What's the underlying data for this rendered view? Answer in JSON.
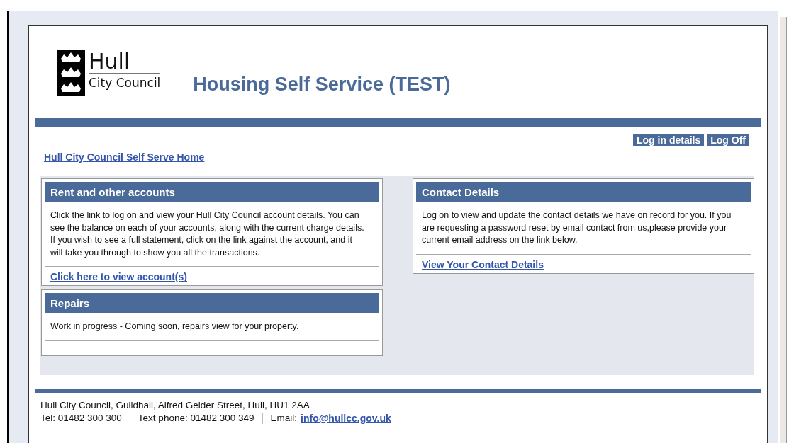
{
  "logo": {
    "name": "Hull",
    "subtitle": "City Council"
  },
  "title": "Housing Self Service (TEST)",
  "top_buttons": [
    "Log in details",
    "Log Off"
  ],
  "home_link": "Hull City Council Self Serve Home",
  "left_panels": [
    {
      "heading": "Rent and other accounts",
      "text": "Click the link to log on and view your Hull City Council account details. You can see the balance on each of your accounts, along with the current charge details. If you wish to see a full statement, click on the link against the account, and it will take you through to show you all the transactions.",
      "link": "Click here to view account(s)"
    },
    {
      "heading": "Repairs",
      "text": "Work in progress - Coming soon, repairs view for your property."
    }
  ],
  "right_panels": [
    {
      "heading": "Contact Details",
      "text": "Log on to view and update the contact details we have on record for you. If you are requesting a password reset by email contact from us,please provide your current email address on the link below.",
      "link": "View Your Contact Details"
    }
  ],
  "footer": {
    "address": "Hull City Council, Guildhall, Alfred Gelder Street, Hull, HU1 2AA",
    "contacts": [
      {
        "kind": "text",
        "text": "Tel: 01482 300 300"
      },
      {
        "kind": "text",
        "text": "Text phone: 01482 300 349"
      },
      {
        "kind": "email",
        "label": "Email:",
        "link": "info@hullcc.gov.uk"
      }
    ]
  }
}
